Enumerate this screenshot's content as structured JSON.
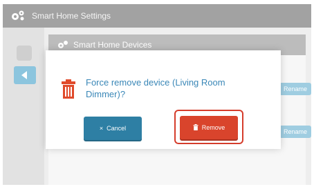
{
  "window": {
    "title": "Smart Home Settings",
    "icon": "gears-icon"
  },
  "panel": {
    "title": "Smart Home Devices",
    "icon": "gears-icon"
  },
  "list": {
    "rename_labels": [
      "Rename",
      "Rename"
    ]
  },
  "dialog": {
    "icon": "trash-icon",
    "message": "Force remove device (Living Room Dimmer)?",
    "cancel_label": "Cancel",
    "cancel_icon": "×",
    "remove_label": "Remove",
    "remove_icon": "trash-icon"
  },
  "colors": {
    "primary": "#2e7fa4",
    "danger": "#d9442c",
    "text_link": "#3a87b7"
  }
}
